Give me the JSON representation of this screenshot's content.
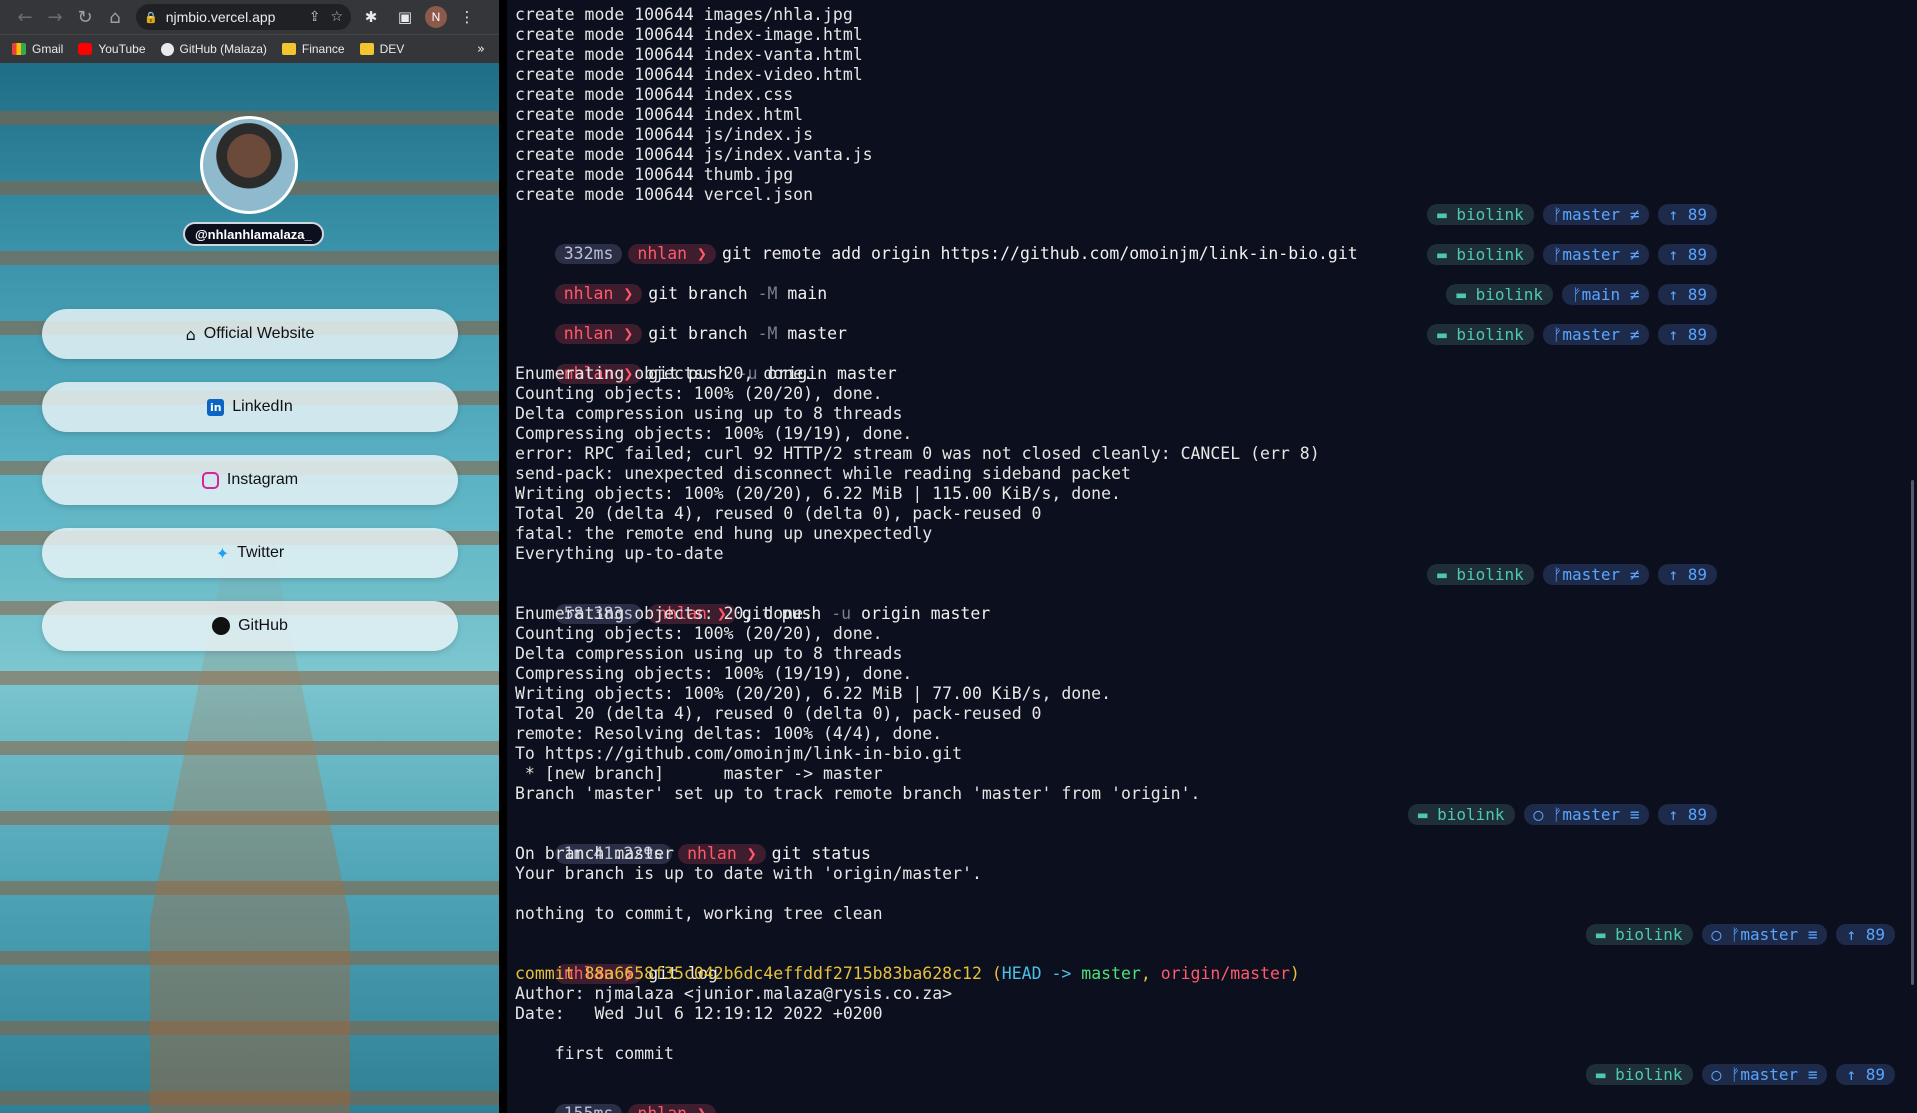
{
  "browser": {
    "url": "njmbio.vercel.app",
    "profile_initial": "N",
    "bookmarks": [
      "Gmail",
      "YouTube",
      "GitHub (Malaza)",
      "Finance",
      "DEV"
    ],
    "bookmarks_more": "»"
  },
  "linkpage": {
    "handle": "@nhlanhlamalaza_",
    "links": [
      "Official Website",
      "LinkedIn",
      "Instagram",
      "Twitter",
      "GitHub"
    ]
  },
  "terminal": {
    "create_lines": [
      "create mode 100644 images/nhla.jpg",
      "create mode 100644 index-image.html",
      "create mode 100644 index-vanta.html",
      "create mode 100644 index-video.html",
      "create mode 100644 index.css",
      "create mode 100644 index.html",
      "create mode 100644 js/index.js",
      "create mode 100644 js/index.vanta.js",
      "create mode 100644 thumb.jpg",
      "create mode 100644 vercel.json"
    ],
    "user": "nhlan ❯",
    "cmd_remote": {
      "time": "332ms",
      "text": "git remote add origin https://github.com/omoinjm/link-in-bio.git"
    },
    "cmd_branch_main": {
      "pre": "git branch ",
      "flag": "-M",
      "post": " main"
    },
    "cmd_branch_master": {
      "pre": "git branch ",
      "flag": "-M",
      "post": " master"
    },
    "cmd_push1": {
      "pre": "git push ",
      "flag": "-u",
      "post": " origin master"
    },
    "push1_output": [
      "Enumerating objects: 20, done.",
      "Counting objects: 100% (20/20), done.",
      "Delta compression using up to 8 threads",
      "Compressing objects: 100% (19/19), done.",
      "error: RPC failed; curl 92 HTTP/2 stream 0 was not closed cleanly: CANCEL (err 8)",
      "send-pack: unexpected disconnect while reading sideband packet",
      "Writing objects: 100% (20/20), 6.22 MiB | 115.00 KiB/s, done.",
      "Total 20 (delta 4), reused 0 (delta 0), pack-reused 0",
      "fatal: the remote end hung up unexpectedly",
      "Everything up-to-date"
    ],
    "cmd_push2": {
      "time": "58.383s",
      "pre": "git push ",
      "flag": "-u",
      "post": " origin master"
    },
    "push2_output": [
      "Enumerating objects: 20, done.",
      "Counting objects: 100% (20/20), done.",
      "Delta compression using up to 8 threads",
      "Compressing objects: 100% (19/19), done.",
      "Writing objects: 100% (20/20), 6.22 MiB | 77.00 KiB/s, done.",
      "Total 20 (delta 4), reused 0 (delta 0), pack-reused 0",
      "remote: Resolving deltas: 100% (4/4), done.",
      "To https://github.com/omoinjm/link-in-bio.git",
      " * [new branch]      master -> master",
      "Branch 'master' set up to track remote branch 'master' from 'origin'."
    ],
    "cmd_status": {
      "time": "1m 41.229s",
      "text": "git status"
    },
    "status_output": [
      "On branch master",
      "Your branch is up to date with 'origin/master'.",
      "",
      "nothing to commit, working tree clean"
    ],
    "cmd_log": {
      "text": "git log"
    },
    "log": {
      "commit_label": "commit ",
      "hash": "88a6658f35c042b6dc4effddf2715b83ba628c12",
      "head": "HEAD -> ",
      "branch": "master",
      "origin": "origin/master",
      "author": "Author: njmalaza <junior.malaza@rysis.co.za>",
      "date": "Date:   Wed Jul 6 12:19:12 2022 +0200",
      "message": "    first commit"
    },
    "last_time": "155ms",
    "prompt_status": [
      {
        "folder": "▬ biolink",
        "branch": "ᚠmaster ≠",
        "count": "↑ 89"
      },
      {
        "folder": "▬ biolink",
        "branch": "ᚠmaster ≠",
        "count": "↑ 89"
      },
      {
        "folder": "▬ biolink",
        "branch": "ᚠmain ≠",
        "count": "↑ 89"
      },
      {
        "folder": "▬ biolink",
        "branch": "ᚠmaster ≠",
        "count": "↑ 89"
      },
      {
        "folder": "▬ biolink",
        "branch": "ᚠmaster ≠",
        "count": "↑ 89"
      },
      {
        "folder": "▬ biolink",
        "branch": "◯ ᚠmaster ≡",
        "count": "↑ 89"
      },
      {
        "folder": "▬ biolink",
        "branch": "◯ ᚠmaster ≡",
        "count": "↑ 89"
      },
      {
        "folder": "▬ biolink",
        "branch": "◯ ᚠmaster ≡",
        "count": "↑ 89"
      }
    ]
  }
}
